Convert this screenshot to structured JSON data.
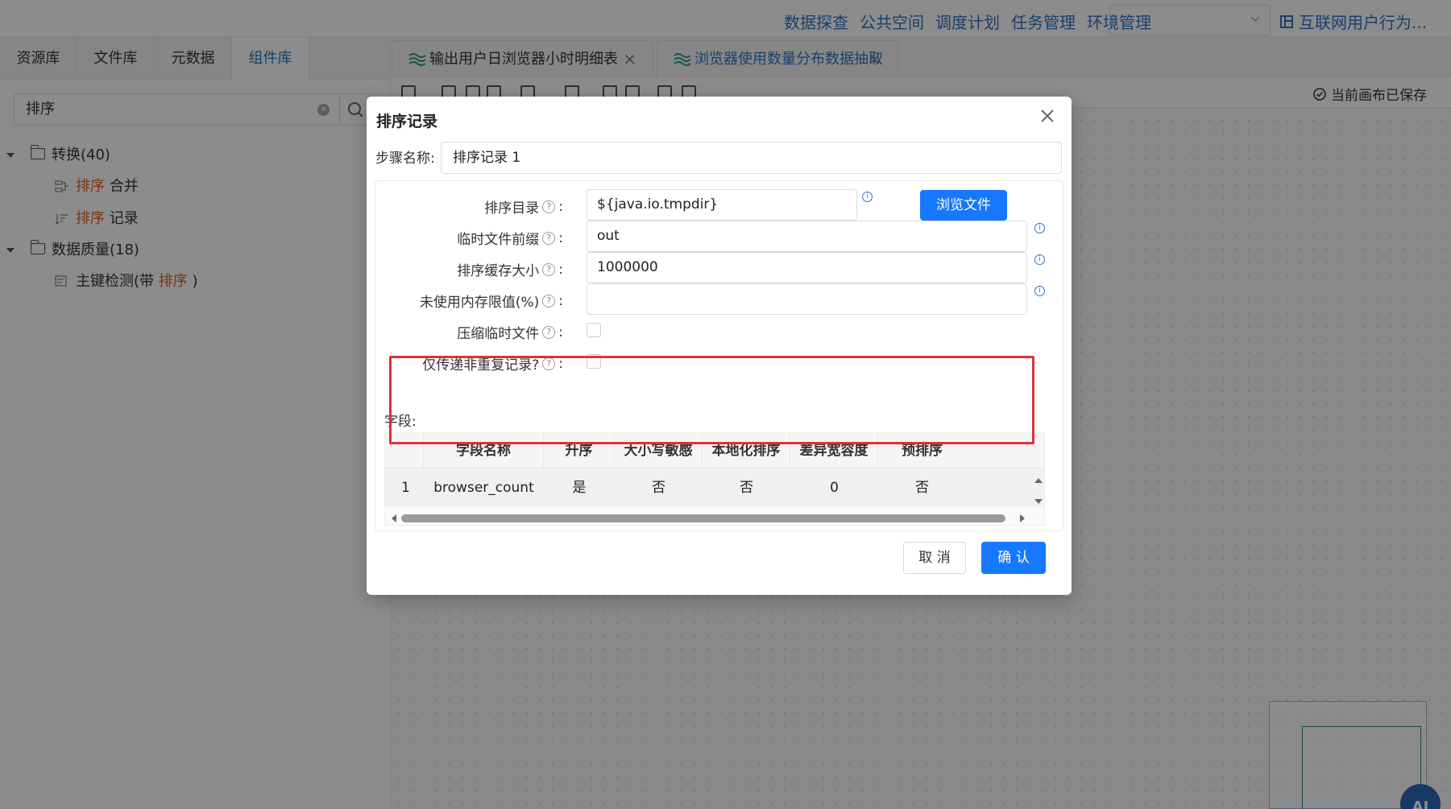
{
  "topnav": {
    "links": [
      "数据探查",
      "公共空间",
      "调度计划",
      "任务管理",
      "环境管理"
    ],
    "select_value": "",
    "project": "互联网用户行为..."
  },
  "left": {
    "tabs": [
      "资源库",
      "文件库",
      "元数据",
      "组件库"
    ],
    "active_tab": "组件库",
    "search_value": "排序",
    "tree": [
      {
        "label": "转换(40)",
        "children": [
          {
            "hl": "排序",
            "rest": " 合并"
          },
          {
            "hl": "排序",
            "rest": " 记录"
          }
        ]
      },
      {
        "label": "数据质量(18)",
        "children": [
          {
            "pre": "主键检测(带 ",
            "hl": "排序",
            "rest": " )"
          }
        ]
      }
    ]
  },
  "main": {
    "tabs": [
      {
        "title": "输出用户日浏览器小时明细表",
        "close": "✕"
      },
      {
        "title": "浏览器使用数量分布数据抽取",
        "close": "✕"
      }
    ],
    "saved_status": "当前画布已保存",
    "ai_label": "AI"
  },
  "dialog": {
    "title": "排序记录",
    "step_name_label": "步骤名称:",
    "step_name_value": "排序记录 1",
    "fields": {
      "sort_dir_label": "排序目录",
      "sort_dir_value": "${java.io.tmpdir}",
      "browse_label": "浏览文件",
      "tmp_prefix_label": "临时文件前缀",
      "tmp_prefix_value": "out",
      "cache_size_label": "排序缓存大小",
      "cache_size_value": "1000000",
      "free_mem_label": "未使用内存限值(%)",
      "free_mem_value": "",
      "compress_label": "压缩临时文件",
      "compress_checked": false,
      "unique_label": "仅传递非重复记录?",
      "unique_checked": false,
      "colon": ":"
    },
    "table": {
      "label": "字段:",
      "columns": [
        "字段名称",
        "升序",
        "大小写敏感",
        "本地化排序",
        "差异宽容度",
        "预排序"
      ],
      "rows": [
        {
          "index": "1",
          "name": "browser_count",
          "asc": "是",
          "case": "否",
          "locale": "否",
          "tolerance": "0",
          "presorted": "否"
        }
      ]
    },
    "cancel_label": "取 消",
    "ok_label": "确 认"
  },
  "colors": {
    "primary": "#1677ff",
    "link": "#2f73c5",
    "highlight": "#e0612b",
    "annotation": "#e0303a"
  }
}
